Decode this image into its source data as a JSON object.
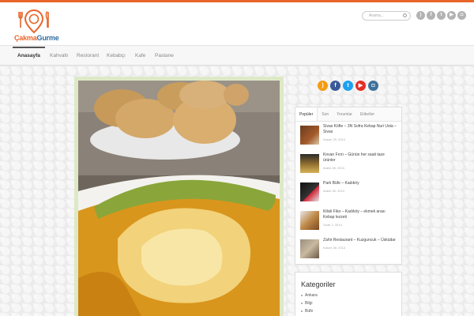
{
  "brand": {
    "part1": "Çakma",
    "part2": "Gurme"
  },
  "search": {
    "placeholder": "Arama..."
  },
  "social": [
    "rss-icon",
    "facebook-icon",
    "twitter-icon",
    "youtube-icon",
    "instagram-icon"
  ],
  "nav": {
    "items": [
      {
        "label": "Anasayfa",
        "active": true
      },
      {
        "label": "Kahvaltı",
        "active": false
      },
      {
        "label": "Restorant",
        "active": false
      },
      {
        "label": "Kebabçı",
        "active": false
      },
      {
        "label": "Kafe",
        "active": false
      },
      {
        "label": "Pastane",
        "active": false
      }
    ]
  },
  "widget": {
    "tabs": [
      "Popüler",
      "Son",
      "Yorumlar",
      "Etiketler"
    ],
    "items": [
      {
        "title": "Sivas Köfte – 3N Sofra Kebap Nuri Usta – Sivas",
        "date": "Kasım 29, 2014"
      },
      {
        "title": "Kovan Fırın – Günün her saati taze ürünler",
        "date": "Aralık 28, 2013"
      },
      {
        "title": "Park Büfe – Kadıköy",
        "date": "Aralık 28, 2013"
      },
      {
        "title": "Kilisli Fiko – Kadıköy – ekmek arası Kebap lezzeti",
        "date": "Ocak 2, 2014"
      },
      {
        "title": "Zahir Restaurant – Kuzguncuk – Üsküdar",
        "date": "Kasım 28, 2013"
      }
    ]
  },
  "categories": {
    "title": "Kategoriler",
    "items": [
      "Ankara",
      "Bilgi",
      "Büfe"
    ]
  },
  "colors": {
    "accent": "#e8662a",
    "brand_blue": "#2e6da4",
    "post_frame": "#dde9c6"
  }
}
